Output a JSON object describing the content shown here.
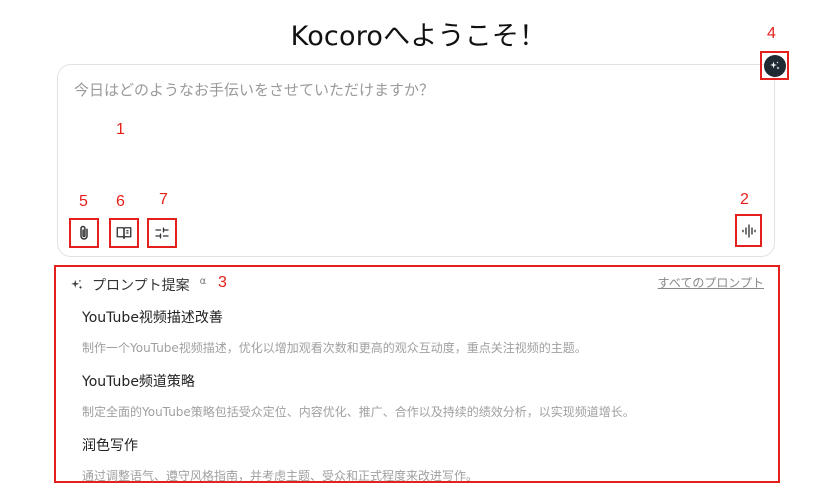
{
  "header": {
    "title": "Kocoroへようこそ！"
  },
  "chat": {
    "placeholder": "今日はどのようなお手伝いをさせていただけますか？"
  },
  "annotations": {
    "n1": "1",
    "n2": "2",
    "n3": "3",
    "n4": "4",
    "n5": "5",
    "n6": "6",
    "n7": "7"
  },
  "toolbar": {
    "attach_icon": "paperclip-icon",
    "library_icon": "book-icon",
    "settings_icon": "sliders-icon",
    "voice_icon": "waveform-icon",
    "magic_icon": "sparkle-icon"
  },
  "prompts": {
    "header_label": "プロンプト提案",
    "header_badge": "α",
    "see_all": "すべてのプロンプト",
    "items": [
      {
        "title": "YouTube视频描述改善",
        "desc": "制作一个YouTube视频描述，优化以增加观看次数和更高的观众互动度，重点关注视频的主题。"
      },
      {
        "title": "YouTube频道策略",
        "desc": "制定全面的YouTube策略包括受众定位、内容优化、推广、合作以及持续的绩效分析，以实现频道增长。"
      },
      {
        "title": "润色写作",
        "desc": "通过调整语气、遵守风格指南，并考虑主题、受众和正式程度来改进写作。"
      }
    ]
  },
  "colors": {
    "annotation": "#e4201c",
    "magic_button": "#1f2a33"
  }
}
